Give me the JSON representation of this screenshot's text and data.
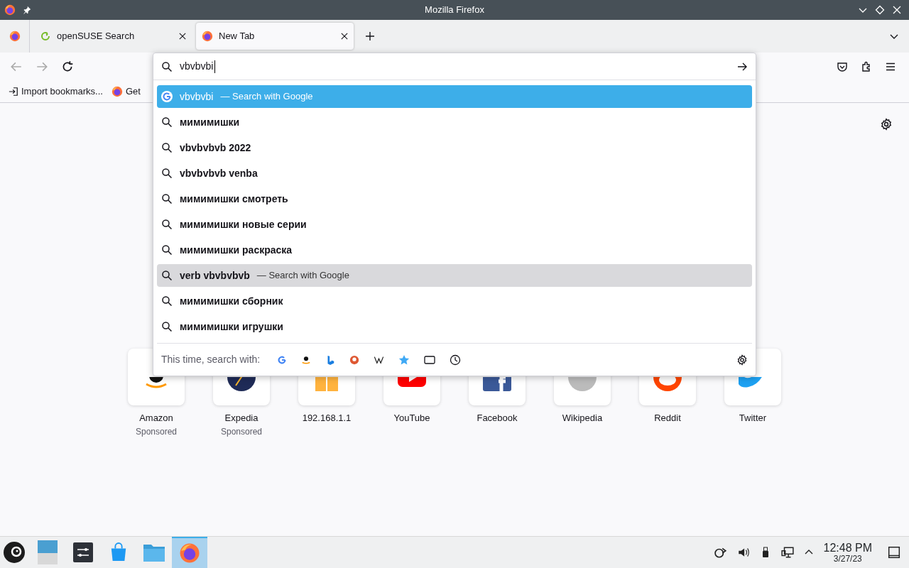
{
  "window": {
    "title": "Mozilla Firefox"
  },
  "tabs": [
    {
      "kind": "pinned",
      "selected": false
    },
    {
      "kind": "normal",
      "label": "openSUSE Search",
      "selected": false
    },
    {
      "kind": "normal",
      "label": "New Tab",
      "selected": true
    }
  ],
  "bookmarks": [
    {
      "label": "Import bookmarks..."
    },
    {
      "label": "Get"
    }
  ],
  "urlbar": {
    "value": "vbvbvbi"
  },
  "suggestions": [
    {
      "kind": "engine",
      "text": "vbvbvbi",
      "action": "— Search with Google",
      "selected": true,
      "hovered": false
    },
    {
      "kind": "suggestion",
      "text": "мимимишки",
      "selected": false,
      "hovered": false
    },
    {
      "kind": "suggestion",
      "text": "vbvbvbvb 2022",
      "selected": false,
      "hovered": false
    },
    {
      "kind": "suggestion",
      "text": "vbvbvbvb venba",
      "selected": false,
      "hovered": false
    },
    {
      "kind": "suggestion",
      "text": "мимимишки смотреть",
      "selected": false,
      "hovered": false
    },
    {
      "kind": "suggestion",
      "text": "мимимишки новые серии",
      "selected": false,
      "hovered": false
    },
    {
      "kind": "suggestion",
      "text": "мимимишки раскраска",
      "selected": false,
      "hovered": false
    },
    {
      "kind": "suggestion",
      "action": "— Search with Google",
      "text": "verb vbvbvbvb",
      "selected": false,
      "hovered": true
    },
    {
      "kind": "suggestion",
      "text": "мимимишки сборник",
      "selected": false,
      "hovered": false
    },
    {
      "kind": "suggestion",
      "text": "мимимишки игрушки",
      "selected": false,
      "hovered": false
    }
  ],
  "search_with": {
    "label": "This time, search with:"
  },
  "top_sites": [
    {
      "title": "Amazon",
      "sponsored": "Sponsored"
    },
    {
      "title": "Expedia",
      "sponsored": "Sponsored"
    },
    {
      "title": "192.168.1.1"
    },
    {
      "title": "YouTube"
    },
    {
      "title": "Facebook"
    },
    {
      "title": "Wikipedia"
    },
    {
      "title": "Reddit"
    },
    {
      "title": "Twitter"
    }
  ],
  "taskbar": {
    "apps": [
      {
        "selected": false
      },
      {
        "selected": false
      },
      {
        "selected": false
      },
      {
        "selected": false
      },
      {
        "selected": true
      }
    ],
    "time": "12:48 PM",
    "date": "3/27/23"
  }
}
